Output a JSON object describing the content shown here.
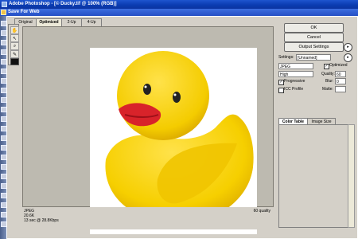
{
  "app": {
    "title": "Adobe Photoshop - [© Ducky.tif @ 100% (RGB)]"
  },
  "dialog": {
    "title": "Save For Web"
  },
  "tabs": [
    {
      "label": "Original"
    },
    {
      "label": "Optimized"
    },
    {
      "label": "2-Up"
    },
    {
      "label": "4-Up"
    }
  ],
  "buttons": {
    "ok": "OK",
    "cancel": "Cancel",
    "output_settings": "Output Settings"
  },
  "settings": {
    "settings_label": "Settings:",
    "preset": "[Unnamed]",
    "format": "JPEG",
    "quality_level": "High",
    "optimized_label": "Optimized",
    "progressive_label": "Progressive",
    "icc_label": "ICC Profile",
    "quality_label": "Quality:",
    "quality_value": "60",
    "blur_label": "Blur:",
    "blur_value": "0",
    "matte_label": "Matte:",
    "optimized_checked": true,
    "progressive_checked": true,
    "icc_checked": false
  },
  "color_tabs": {
    "color_table": "Color Table",
    "image_size": "Image Size"
  },
  "status": {
    "format": "JPEG",
    "size": "20.6K",
    "time": "13 sec @ 28.8Kbps",
    "quality": "60 quality"
  },
  "colors": {
    "duck": "#f6d000",
    "beak": "#d8232a",
    "accent": "#0b3bb0"
  }
}
